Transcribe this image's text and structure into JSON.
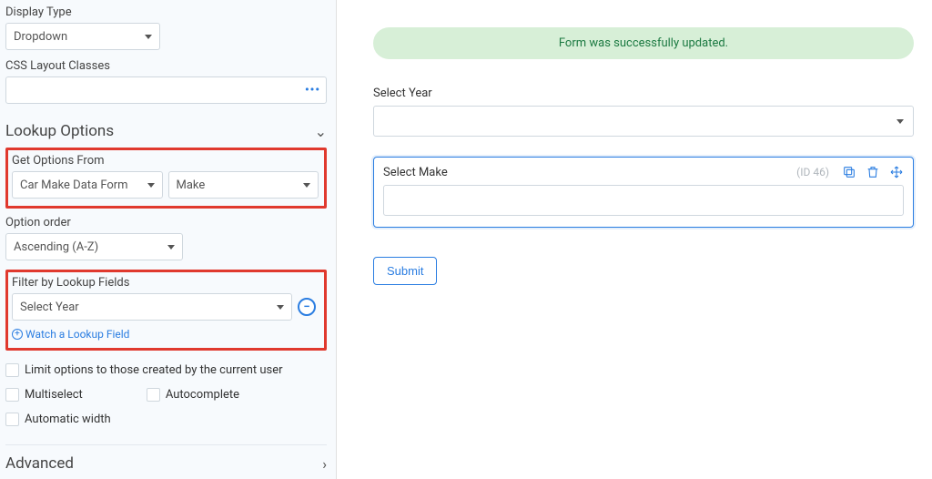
{
  "sidebar": {
    "display_type_label": "Display Type",
    "display_type_value": "Dropdown",
    "css_layout_label": "CSS Layout Classes",
    "css_layout_value": "",
    "lookup_section": "Lookup Options",
    "get_options_from_label": "Get Options From",
    "get_options_from_form": "Car Make Data Form",
    "get_options_from_field": "Make",
    "option_order_label": "Option order",
    "option_order_value": "Ascending (A-Z)",
    "filter_by_label": "Filter by Lookup Fields",
    "filter_by_value": "Select Year",
    "watch_link": "Watch a Lookup Field",
    "limit_options_label": "Limit options to those created by the current user",
    "multiselect_label": "Multiselect",
    "autocomplete_label": "Autocomplete",
    "automatic_width_label": "Automatic width",
    "advanced_section": "Advanced"
  },
  "main": {
    "success_alert": "Form was successfully updated.",
    "select_year_label": "Select Year",
    "select_make_label": "Select Make",
    "field_id": "(ID 46)",
    "submit_label": "Submit"
  }
}
